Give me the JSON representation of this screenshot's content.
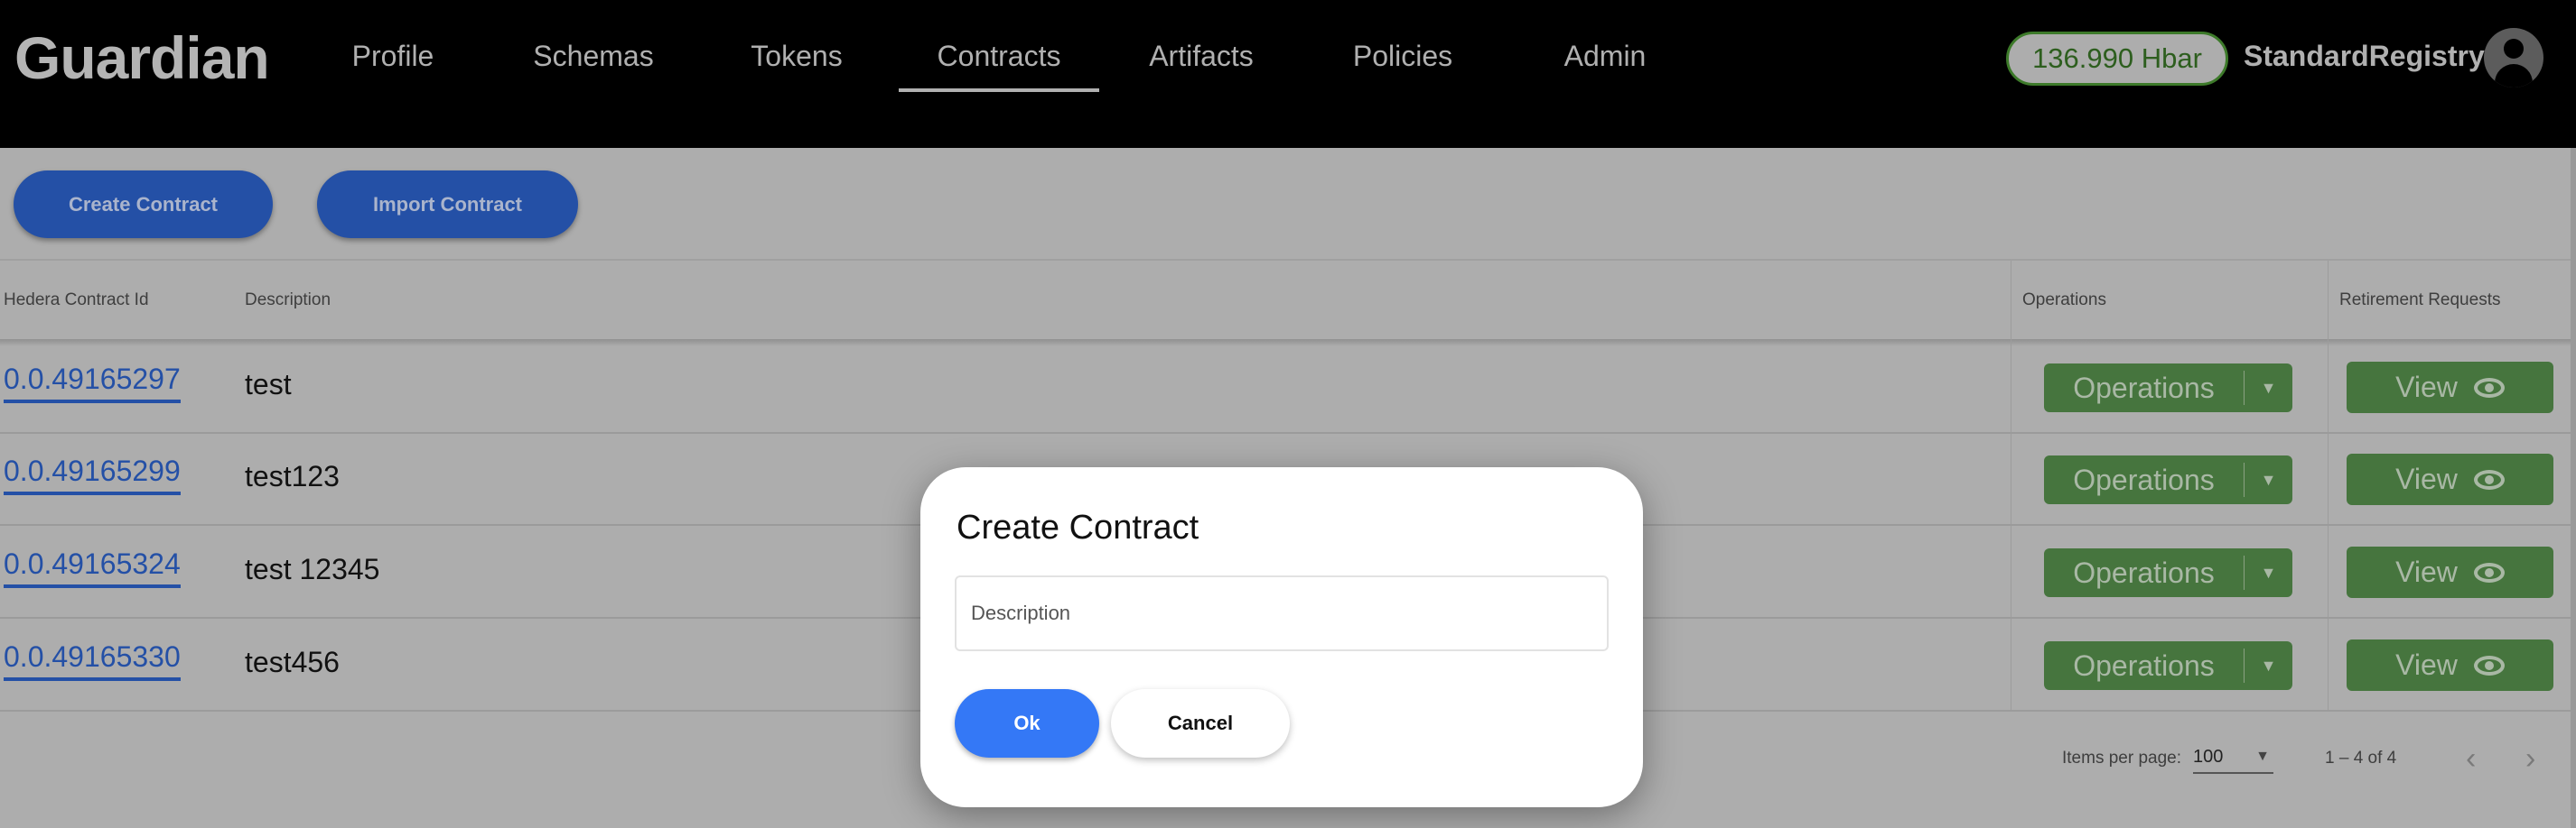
{
  "header": {
    "logo": "Guardian",
    "nav": [
      {
        "label": "Profile"
      },
      {
        "label": "Schemas"
      },
      {
        "label": "Tokens"
      },
      {
        "label": "Contracts",
        "active": true
      },
      {
        "label": "Artifacts"
      },
      {
        "label": "Policies"
      },
      {
        "label": "Admin"
      }
    ],
    "balance": "136.990 Hbar",
    "username": "StandardRegistry",
    "avatar_icon": "account-circle-icon"
  },
  "toolbar": {
    "create_label": "Create Contract",
    "import_label": "Import Contract"
  },
  "table": {
    "columns": [
      "Hedera Contract Id",
      "Description",
      "Operations",
      "Retirement Requests"
    ],
    "rows": [
      {
        "id": "0.0.49165297",
        "description": "test",
        "operations": "Operations",
        "view": "View"
      },
      {
        "id": "0.0.49165299",
        "description": "test123",
        "operations": "Operations",
        "view": "View"
      },
      {
        "id": "0.0.49165324",
        "description": "test 12345",
        "operations": "Operations",
        "view": "View"
      },
      {
        "id": "0.0.49165330",
        "description": "test456",
        "operations": "Operations",
        "view": "View"
      }
    ]
  },
  "pagination": {
    "items_per_page_label": "Items per page:",
    "items_per_page": "100",
    "range": "1 – 4 of 4"
  },
  "dialog": {
    "title": "Create Contract",
    "description_placeholder": "Description",
    "description_value": "",
    "ok_label": "Ok",
    "cancel_label": "Cancel"
  },
  "colors": {
    "header_bg": "#000000",
    "primary_button": "#2450a6",
    "ok_button": "#3478f6",
    "operations_button": "#46753e",
    "balance_border": "#3d7a2a"
  }
}
